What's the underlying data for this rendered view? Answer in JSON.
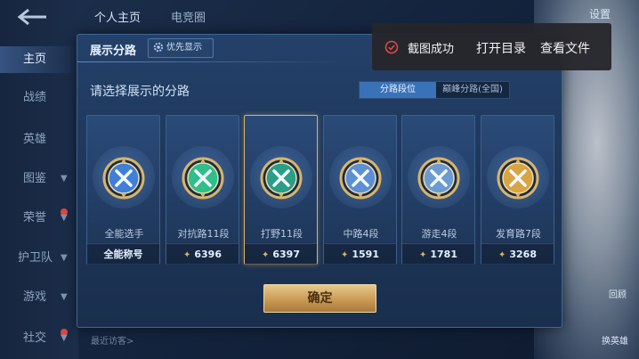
{
  "sidebar": {
    "back_icon": "back-arrow-icon",
    "items": [
      {
        "label": "主页",
        "active": true,
        "chevron": false
      },
      {
        "label": "战绩",
        "active": false,
        "chevron": false
      },
      {
        "label": "英雄",
        "active": false,
        "chevron": false
      },
      {
        "label": "图鉴",
        "active": false,
        "chevron": true
      },
      {
        "label": "荣誉",
        "active": false,
        "chevron": true
      },
      {
        "label": "护卫队",
        "active": false,
        "chevron": true
      },
      {
        "label": "游戏",
        "active": false,
        "chevron": true
      },
      {
        "label": "社交",
        "active": false,
        "chevron": true
      }
    ]
  },
  "top_tabs": [
    "个人主页",
    "电竞圈"
  ],
  "top_right_button": "设置",
  "recent_visitors": "最近访客>",
  "right_side": {
    "label1": "回顾",
    "label2": "换英雄"
  },
  "modal": {
    "title": "展示分路",
    "priority_button": "优先显示",
    "prompt": "请选择展示的分路",
    "segments": {
      "active": "分路段位",
      "inactive": "巅峰分路(全国)"
    },
    "cards": [
      {
        "name": "全能选手",
        "footer": "全能称号",
        "has_star": false,
        "selected": false,
        "badge_color": "#3f7fd8",
        "badge_icon": "allround-badge-icon"
      },
      {
        "name": "对抗路11段",
        "footer": "6396",
        "has_star": true,
        "selected": false,
        "badge_color": "#2fbf8a",
        "badge_icon": "clash-lane-badge-icon"
      },
      {
        "name": "打野11段",
        "footer": "6397",
        "has_star": true,
        "selected": true,
        "badge_color": "#2a9e86",
        "badge_icon": "jungle-badge-icon"
      },
      {
        "name": "中路4段",
        "footer": "1591",
        "has_star": true,
        "selected": false,
        "badge_color": "#5b8fd6",
        "badge_icon": "mid-lane-badge-icon"
      },
      {
        "name": "游走4段",
        "footer": "1781",
        "has_star": true,
        "selected": false,
        "badge_color": "#6c9bd2",
        "badge_icon": "roam-badge-icon"
      },
      {
        "name": "发育路7段",
        "footer": "3268",
        "has_star": true,
        "selected": false,
        "badge_color": "#d9a441",
        "badge_icon": "farm-lane-badge-icon"
      }
    ],
    "confirm_label": "确定"
  },
  "toast": {
    "status": "截图成功",
    "open_dir": "打开目录",
    "view_file": "查看文件",
    "status_color": "#e04848"
  }
}
